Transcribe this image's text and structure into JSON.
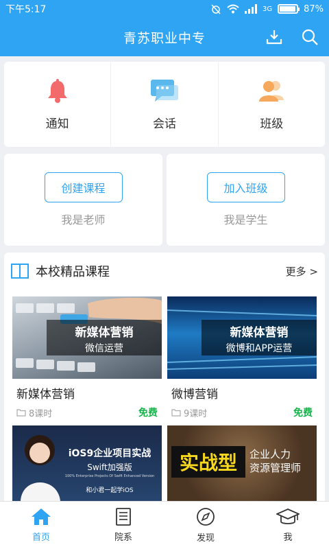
{
  "status": {
    "time": "下午5:17",
    "net": "3G",
    "battery": "87%"
  },
  "header": {
    "title": "青苏职业中专"
  },
  "quick": [
    {
      "label": "通知",
      "icon": "bell-icon"
    },
    {
      "label": "会话",
      "icon": "chat-icon"
    },
    {
      "label": "班级",
      "icon": "people-icon"
    }
  ],
  "roles": [
    {
      "button": "创建课程",
      "sub": "我是老师"
    },
    {
      "button": "加入班级",
      "sub": "我是学生"
    }
  ],
  "section": {
    "title": "本校精品课程",
    "more": "更多 >"
  },
  "courses": [
    {
      "title": "新媒体营销",
      "hours": "8课时",
      "price": "免费",
      "banner_main": "新媒体营销",
      "banner_sub": "微信运营"
    },
    {
      "title": "微博营销",
      "hours": "9课时",
      "price": "免费",
      "banner_main": "新媒体营销",
      "banner_sub": "微博和APP运营"
    },
    {
      "banner_main": "iOS9企业项目实战",
      "banner_sub": "Swift加强版",
      "banner_en": "100% Enterprise Projects Of Swift Enhanced Version",
      "banner_foot": "和小君一起学iOS"
    },
    {
      "banner_main": "实战型",
      "banner_sub": "企业人力",
      "banner_sub2": "资源管理师"
    }
  ],
  "tabs": [
    {
      "label": "首页",
      "icon": "home-icon"
    },
    {
      "label": "院系",
      "icon": "document-icon"
    },
    {
      "label": "发现",
      "icon": "compass-icon"
    },
    {
      "label": "我",
      "icon": "graduation-cap-icon"
    }
  ],
  "colors": {
    "primary": "#2fa4f3",
    "free": "#15b34a"
  }
}
